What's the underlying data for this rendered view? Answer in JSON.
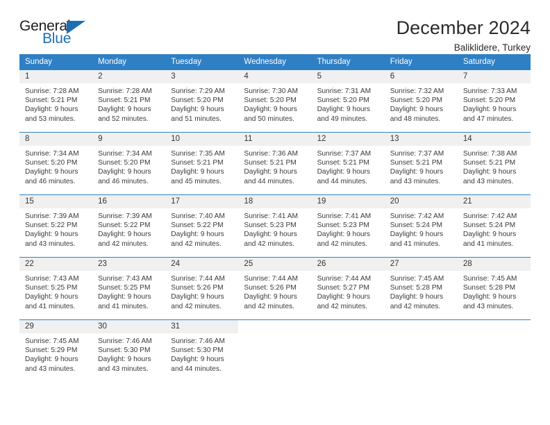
{
  "logo": {
    "word_top": "General",
    "word_bottom": "Blue",
    "accent_color": "#1a6fb5",
    "triangle_icon": "triangle-icon"
  },
  "header": {
    "title": "December 2024",
    "subtitle": "Baliklidere, Turkey"
  },
  "calendar": {
    "header_color": "#2f7fc4",
    "daynum_band_color": "#f0f0f0",
    "weekday_headers": [
      "Sunday",
      "Monday",
      "Tuesday",
      "Wednesday",
      "Thursday",
      "Friday",
      "Saturday"
    ],
    "weeks": [
      [
        {
          "day": "1",
          "sunrise": "Sunrise: 7:28 AM",
          "sunset": "Sunset: 5:21 PM",
          "daylight_line1": "Daylight: 9 hours",
          "daylight_line2": "and 53 minutes."
        },
        {
          "day": "2",
          "sunrise": "Sunrise: 7:28 AM",
          "sunset": "Sunset: 5:21 PM",
          "daylight_line1": "Daylight: 9 hours",
          "daylight_line2": "and 52 minutes."
        },
        {
          "day": "3",
          "sunrise": "Sunrise: 7:29 AM",
          "sunset": "Sunset: 5:20 PM",
          "daylight_line1": "Daylight: 9 hours",
          "daylight_line2": "and 51 minutes."
        },
        {
          "day": "4",
          "sunrise": "Sunrise: 7:30 AM",
          "sunset": "Sunset: 5:20 PM",
          "daylight_line1": "Daylight: 9 hours",
          "daylight_line2": "and 50 minutes."
        },
        {
          "day": "5",
          "sunrise": "Sunrise: 7:31 AM",
          "sunset": "Sunset: 5:20 PM",
          "daylight_line1": "Daylight: 9 hours",
          "daylight_line2": "and 49 minutes."
        },
        {
          "day": "6",
          "sunrise": "Sunrise: 7:32 AM",
          "sunset": "Sunset: 5:20 PM",
          "daylight_line1": "Daylight: 9 hours",
          "daylight_line2": "and 48 minutes."
        },
        {
          "day": "7",
          "sunrise": "Sunrise: 7:33 AM",
          "sunset": "Sunset: 5:20 PM",
          "daylight_line1": "Daylight: 9 hours",
          "daylight_line2": "and 47 minutes."
        }
      ],
      [
        {
          "day": "8",
          "sunrise": "Sunrise: 7:34 AM",
          "sunset": "Sunset: 5:20 PM",
          "daylight_line1": "Daylight: 9 hours",
          "daylight_line2": "and 46 minutes."
        },
        {
          "day": "9",
          "sunrise": "Sunrise: 7:34 AM",
          "sunset": "Sunset: 5:20 PM",
          "daylight_line1": "Daylight: 9 hours",
          "daylight_line2": "and 46 minutes."
        },
        {
          "day": "10",
          "sunrise": "Sunrise: 7:35 AM",
          "sunset": "Sunset: 5:21 PM",
          "daylight_line1": "Daylight: 9 hours",
          "daylight_line2": "and 45 minutes."
        },
        {
          "day": "11",
          "sunrise": "Sunrise: 7:36 AM",
          "sunset": "Sunset: 5:21 PM",
          "daylight_line1": "Daylight: 9 hours",
          "daylight_line2": "and 44 minutes."
        },
        {
          "day": "12",
          "sunrise": "Sunrise: 7:37 AM",
          "sunset": "Sunset: 5:21 PM",
          "daylight_line1": "Daylight: 9 hours",
          "daylight_line2": "and 44 minutes."
        },
        {
          "day": "13",
          "sunrise": "Sunrise: 7:37 AM",
          "sunset": "Sunset: 5:21 PM",
          "daylight_line1": "Daylight: 9 hours",
          "daylight_line2": "and 43 minutes."
        },
        {
          "day": "14",
          "sunrise": "Sunrise: 7:38 AM",
          "sunset": "Sunset: 5:21 PM",
          "daylight_line1": "Daylight: 9 hours",
          "daylight_line2": "and 43 minutes."
        }
      ],
      [
        {
          "day": "15",
          "sunrise": "Sunrise: 7:39 AM",
          "sunset": "Sunset: 5:22 PM",
          "daylight_line1": "Daylight: 9 hours",
          "daylight_line2": "and 43 minutes."
        },
        {
          "day": "16",
          "sunrise": "Sunrise: 7:39 AM",
          "sunset": "Sunset: 5:22 PM",
          "daylight_line1": "Daylight: 9 hours",
          "daylight_line2": "and 42 minutes."
        },
        {
          "day": "17",
          "sunrise": "Sunrise: 7:40 AM",
          "sunset": "Sunset: 5:22 PM",
          "daylight_line1": "Daylight: 9 hours",
          "daylight_line2": "and 42 minutes."
        },
        {
          "day": "18",
          "sunrise": "Sunrise: 7:41 AM",
          "sunset": "Sunset: 5:23 PM",
          "daylight_line1": "Daylight: 9 hours",
          "daylight_line2": "and 42 minutes."
        },
        {
          "day": "19",
          "sunrise": "Sunrise: 7:41 AM",
          "sunset": "Sunset: 5:23 PM",
          "daylight_line1": "Daylight: 9 hours",
          "daylight_line2": "and 42 minutes."
        },
        {
          "day": "20",
          "sunrise": "Sunrise: 7:42 AM",
          "sunset": "Sunset: 5:24 PM",
          "daylight_line1": "Daylight: 9 hours",
          "daylight_line2": "and 41 minutes."
        },
        {
          "day": "21",
          "sunrise": "Sunrise: 7:42 AM",
          "sunset": "Sunset: 5:24 PM",
          "daylight_line1": "Daylight: 9 hours",
          "daylight_line2": "and 41 minutes."
        }
      ],
      [
        {
          "day": "22",
          "sunrise": "Sunrise: 7:43 AM",
          "sunset": "Sunset: 5:25 PM",
          "daylight_line1": "Daylight: 9 hours",
          "daylight_line2": "and 41 minutes."
        },
        {
          "day": "23",
          "sunrise": "Sunrise: 7:43 AM",
          "sunset": "Sunset: 5:25 PM",
          "daylight_line1": "Daylight: 9 hours",
          "daylight_line2": "and 41 minutes."
        },
        {
          "day": "24",
          "sunrise": "Sunrise: 7:44 AM",
          "sunset": "Sunset: 5:26 PM",
          "daylight_line1": "Daylight: 9 hours",
          "daylight_line2": "and 42 minutes."
        },
        {
          "day": "25",
          "sunrise": "Sunrise: 7:44 AM",
          "sunset": "Sunset: 5:26 PM",
          "daylight_line1": "Daylight: 9 hours",
          "daylight_line2": "and 42 minutes."
        },
        {
          "day": "26",
          "sunrise": "Sunrise: 7:44 AM",
          "sunset": "Sunset: 5:27 PM",
          "daylight_line1": "Daylight: 9 hours",
          "daylight_line2": "and 42 minutes."
        },
        {
          "day": "27",
          "sunrise": "Sunrise: 7:45 AM",
          "sunset": "Sunset: 5:28 PM",
          "daylight_line1": "Daylight: 9 hours",
          "daylight_line2": "and 42 minutes."
        },
        {
          "day": "28",
          "sunrise": "Sunrise: 7:45 AM",
          "sunset": "Sunset: 5:28 PM",
          "daylight_line1": "Daylight: 9 hours",
          "daylight_line2": "and 43 minutes."
        }
      ],
      [
        {
          "day": "29",
          "sunrise": "Sunrise: 7:45 AM",
          "sunset": "Sunset: 5:29 PM",
          "daylight_line1": "Daylight: 9 hours",
          "daylight_line2": "and 43 minutes."
        },
        {
          "day": "30",
          "sunrise": "Sunrise: 7:46 AM",
          "sunset": "Sunset: 5:30 PM",
          "daylight_line1": "Daylight: 9 hours",
          "daylight_line2": "and 43 minutes."
        },
        {
          "day": "31",
          "sunrise": "Sunrise: 7:46 AM",
          "sunset": "Sunset: 5:30 PM",
          "daylight_line1": "Daylight: 9 hours",
          "daylight_line2": "and 44 minutes."
        },
        {
          "day": "",
          "sunrise": "",
          "sunset": "",
          "daylight_line1": "",
          "daylight_line2": ""
        },
        {
          "day": "",
          "sunrise": "",
          "sunset": "",
          "daylight_line1": "",
          "daylight_line2": ""
        },
        {
          "day": "",
          "sunrise": "",
          "sunset": "",
          "daylight_line1": "",
          "daylight_line2": ""
        },
        {
          "day": "",
          "sunrise": "",
          "sunset": "",
          "daylight_line1": "",
          "daylight_line2": ""
        }
      ]
    ]
  }
}
